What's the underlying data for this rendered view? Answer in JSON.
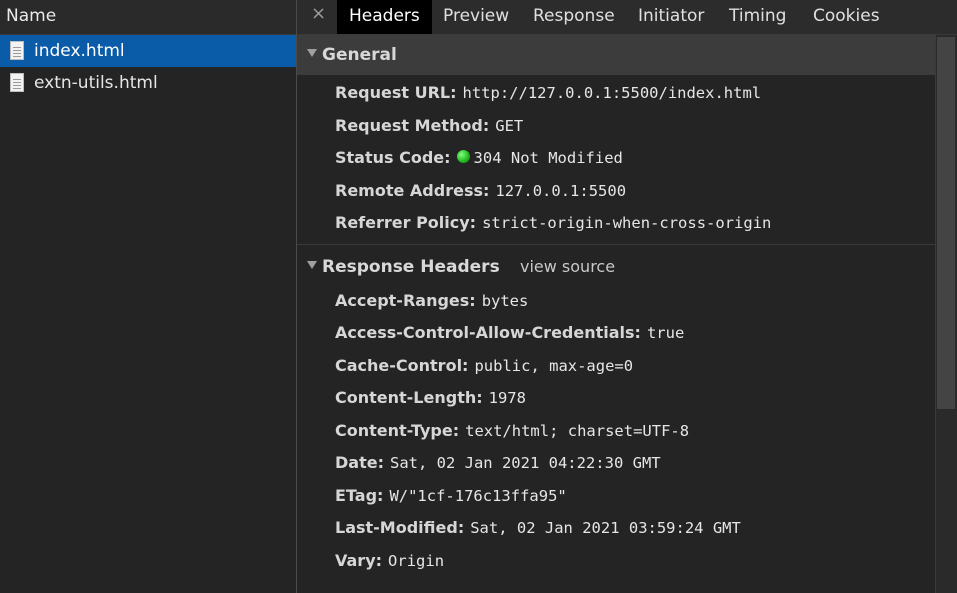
{
  "files": {
    "header": "Name",
    "items": [
      {
        "name": "index.html"
      },
      {
        "name": "extn-utils.html"
      }
    ]
  },
  "tabs": {
    "close_symbol": "×",
    "items": [
      "Headers",
      "Preview",
      "Response",
      "Initiator",
      "Timing",
      "Cookies"
    ],
    "active": "Headers"
  },
  "general": {
    "title": "General",
    "rows": [
      {
        "key": "Request URL:",
        "value": "http://127.0.0.1:5500/index.html"
      },
      {
        "key": "Request Method:",
        "value": "GET"
      },
      {
        "key": "Status Code:",
        "value": "304 Not Modified"
      },
      {
        "key": "Remote Address:",
        "value": "127.0.0.1:5500"
      },
      {
        "key": "Referrer Policy:",
        "value": "strict-origin-when-cross-origin"
      }
    ]
  },
  "response_headers": {
    "title": "Response Headers",
    "view_source": "view source",
    "rows": [
      {
        "key": "Accept-Ranges:",
        "value": "bytes"
      },
      {
        "key": "Access-Control-Allow-Credentials:",
        "value": "true"
      },
      {
        "key": "Cache-Control:",
        "value": "public, max-age=0"
      },
      {
        "key": "Content-Length:",
        "value": "1978"
      },
      {
        "key": "Content-Type:",
        "value": "text/html; charset=UTF-8"
      },
      {
        "key": "Date:",
        "value": "Sat, 02 Jan 2021 04:22:30 GMT"
      },
      {
        "key": "ETag:",
        "value": "W/\"1cf-176c13ffa95\""
      },
      {
        "key": "Last-Modified:",
        "value": "Sat, 02 Jan 2021 03:59:24 GMT"
      },
      {
        "key": "Vary:",
        "value": "Origin"
      }
    ]
  },
  "colors": {
    "selected_row": "#0b5ca8",
    "status_ok": "#1fb51f",
    "background": "#242424"
  }
}
